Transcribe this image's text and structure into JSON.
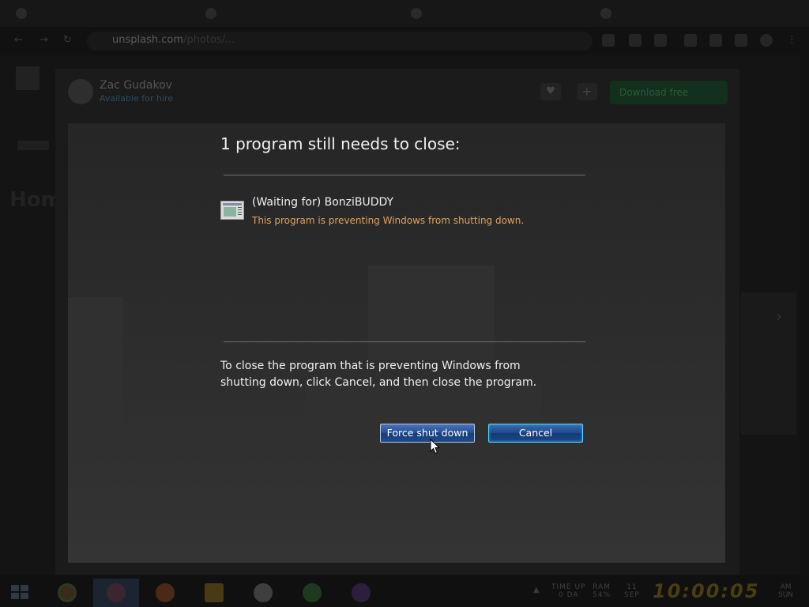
{
  "browser": {
    "url_host": "unsplash.com",
    "url_rest": "/photos/..."
  },
  "background_page": {
    "author_name": "Zac Gudakov",
    "author_sub": "Available for hire",
    "download_label": "Download free",
    "left_heading": "Hom"
  },
  "dialog": {
    "title": "1 program still needs to close:",
    "program_name": "(Waiting for) BonziBUDDY",
    "program_status": "This program is preventing Windows from shutting down.",
    "instructions": "To close the program that is preventing Windows from shutting down, click Cancel, and then close the program.",
    "force_button": "Force shut down",
    "cancel_button": "Cancel",
    "status_color": "#e0a35c",
    "button_color": "#234f97"
  },
  "taskbar": {
    "apps": [
      "chrome-icon",
      "colorful-app-icon",
      "firefox-icon",
      "file-explorer-icon",
      "yandex-browser-icon",
      "green-app-icon",
      "purple-app-icon"
    ],
    "tray_timer_label": "TIME UP",
    "tray_timer_value": "0 DA",
    "tray_ram_label": "RAM",
    "tray_ram_value": "54%",
    "tray_date_top": "11",
    "tray_date_bottom": "SEP",
    "clock": "10:00:05",
    "ampm": "AM",
    "day": "SUN"
  }
}
